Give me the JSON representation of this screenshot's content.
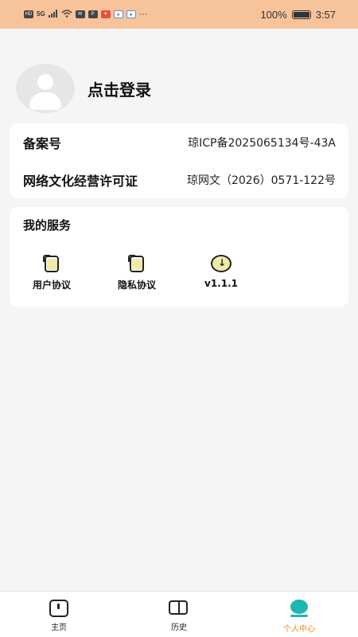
{
  "status_bar": {
    "left_icons": [
      "HD",
      "5G",
      "signal",
      "wifi",
      "mail",
      "app-p",
      "app-red",
      "app-blue",
      "app-blue"
    ],
    "more": "···",
    "battery_text": "100%",
    "time": "3:57"
  },
  "profile": {
    "login_label": "点击登录"
  },
  "license": {
    "icp_label": "备案号",
    "icp_value": "琼ICP备2025065134号-43A",
    "culture_label": "网络文化经营许可证",
    "culture_value": "琼网文（2026）0571-122号"
  },
  "services": {
    "title": "我的服务",
    "items": [
      {
        "label": "用户协议",
        "icon": "document-icon"
      },
      {
        "label": "隐私协议",
        "icon": "document-icon"
      },
      {
        "label": "v1.1.1",
        "icon": "download-icon"
      }
    ]
  },
  "tabbar": {
    "tabs": [
      {
        "label": "主页",
        "icon": "home-icon",
        "active": false
      },
      {
        "label": "历史",
        "icon": "book-icon",
        "active": false
      },
      {
        "label": "个人中心",
        "icon": "profile-icon",
        "active": true
      }
    ],
    "active_color": "#f08a1c"
  },
  "colors": {
    "status_bar_bg": "#f7c39b",
    "page_bg": "#f5f5f5",
    "accent": "#1fb6b0",
    "doc_fill": "#f1e9a8"
  }
}
